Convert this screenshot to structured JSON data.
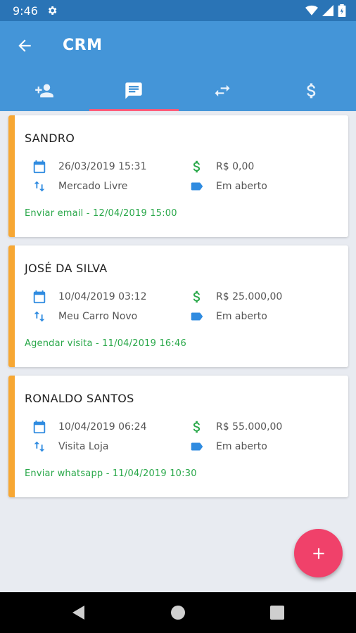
{
  "status_bar": {
    "time": "9:46",
    "icons": [
      "gear-icon",
      "wifi-icon",
      "signal-icon",
      "battery-icon"
    ]
  },
  "app_bar": {
    "title": "CRM",
    "back_icon": "arrow-left-icon"
  },
  "tabs": [
    {
      "icon": "person-add-icon",
      "active": false
    },
    {
      "icon": "message-icon",
      "active": true
    },
    {
      "icon": "swap-icon",
      "active": false
    },
    {
      "icon": "dollar-icon",
      "active": false
    }
  ],
  "cards": [
    {
      "name": "SANDRO",
      "date": "26/03/2019 15:31",
      "value": "R$ 0,00",
      "source": "Mercado Livre",
      "status": "Em aberto",
      "next_task": "Enviar email - 12/04/2019 15:00"
    },
    {
      "name": "JOSÉ DA SILVA",
      "date": "10/04/2019 03:12",
      "value": "R$ 25.000,00",
      "source": "Meu Carro Novo",
      "status": "Em aberto",
      "next_task": "Agendar visita - 11/04/2019 16:46"
    },
    {
      "name": "RONALDO SANTOS",
      "date": "10/04/2019 06:24",
      "value": "R$ 55.000,00",
      "source": "Visita Loja",
      "status": "Em aberto",
      "next_task": "Enviar whatsapp - 11/04/2019 10:30"
    }
  ],
  "fab": {
    "icon": "plus-icon"
  },
  "colors": {
    "primary": "#4495d8",
    "primary_dark": "#2a74b6",
    "accent": "#f0416a",
    "card_accent": "#f7a733",
    "task_green": "#2aa84a",
    "money_green": "#2aa84a",
    "icon_blue": "#2f8be0"
  }
}
